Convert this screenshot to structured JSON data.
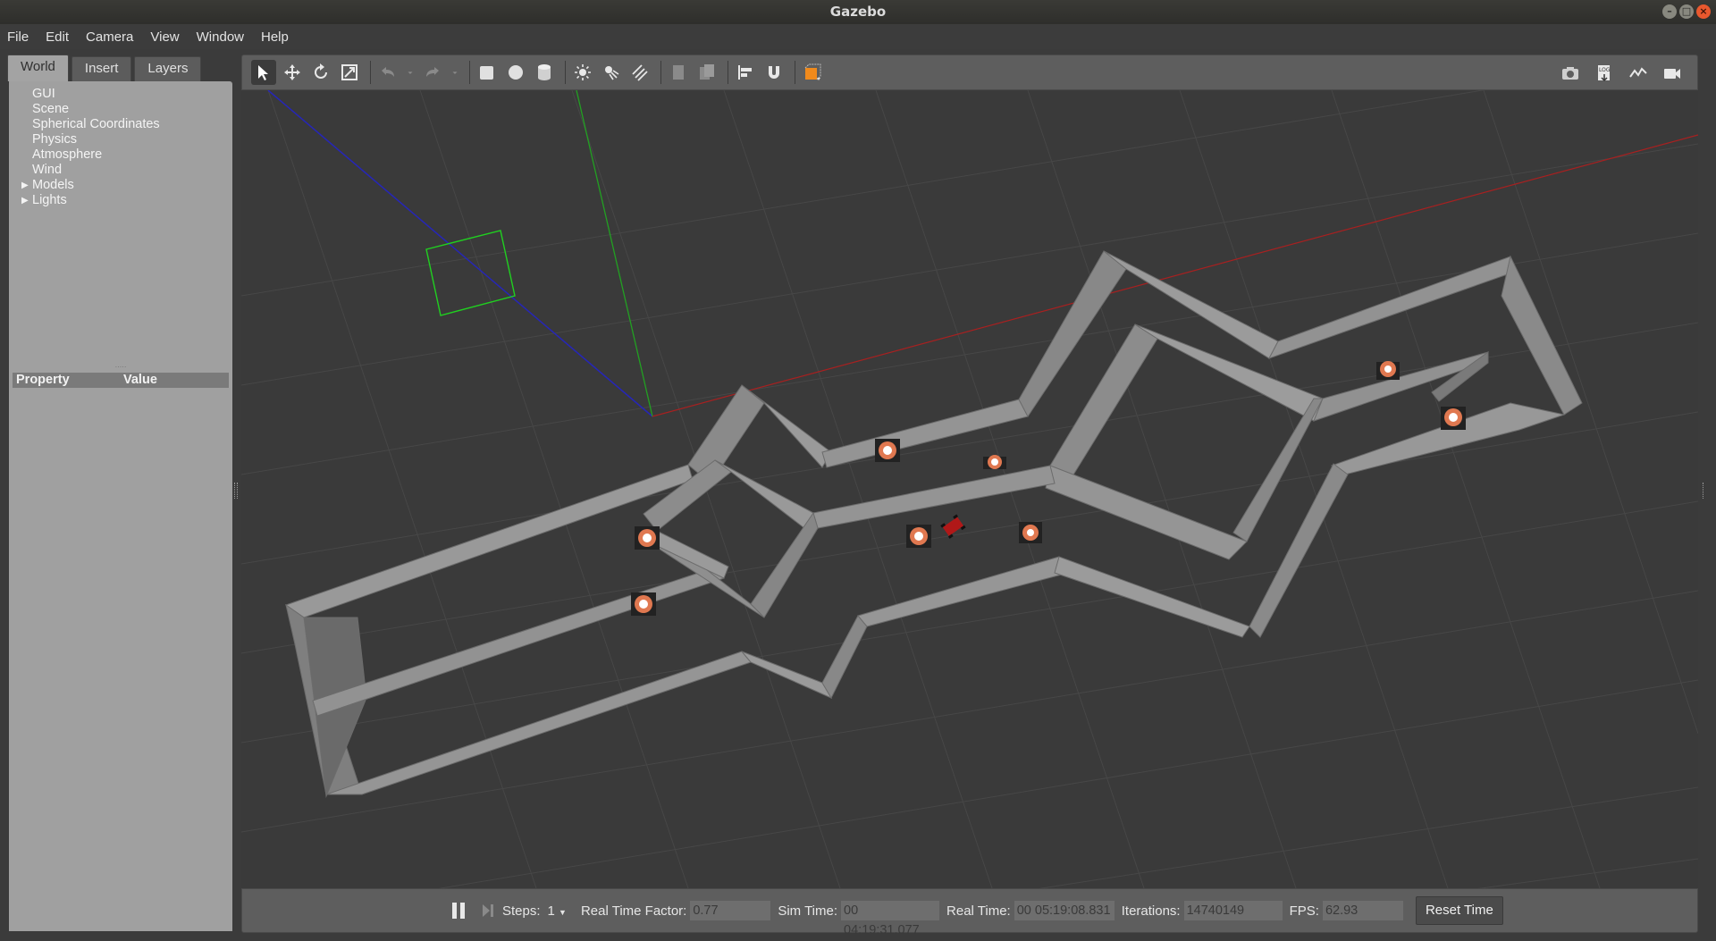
{
  "window": {
    "title": "Gazebo"
  },
  "menu": [
    {
      "label": "File"
    },
    {
      "label": "Edit"
    },
    {
      "label": "Camera"
    },
    {
      "label": "View"
    },
    {
      "label": "Window"
    },
    {
      "label": "Help"
    }
  ],
  "left_panel": {
    "tabs": [
      {
        "label": "World"
      },
      {
        "label": "Insert"
      },
      {
        "label": "Layers"
      }
    ],
    "active_tab": "World",
    "tree": [
      {
        "label": "GUI"
      },
      {
        "label": "Scene"
      },
      {
        "label": "Spherical Coordinates"
      },
      {
        "label": "Physics"
      },
      {
        "label": "Atmosphere"
      },
      {
        "label": "Wind"
      },
      {
        "label": "Models"
      },
      {
        "label": "Lights"
      }
    ],
    "properties": {
      "col_property": "Property",
      "col_value": "Value"
    }
  },
  "toolbar": {
    "left_icons": [
      "select-arrow-icon",
      "translate-icon",
      "rotate-icon",
      "scale-icon",
      "undo-icon",
      "undo-dropdown-icon",
      "redo-icon",
      "redo-dropdown-icon",
      "box-icon",
      "sphere-icon",
      "cylinder-icon",
      "point-light-icon",
      "spot-light-icon",
      "directional-light-icon",
      "copy-icon",
      "paste-icon",
      "align-icon",
      "snap-magnet-icon",
      "view-angle-icon"
    ],
    "right_icons": [
      "screenshot-camera-icon",
      "log-icon",
      "plot-icon",
      "video-record-icon"
    ]
  },
  "bottom_bar": {
    "steps_label": "Steps:",
    "steps_value": "1",
    "rtf_label": "Real Time Factor:",
    "rtf_value": "0.77",
    "sim_time_label": "Sim Time:",
    "sim_time_value": "00 04:19:31.077",
    "real_time_label": "Real Time:",
    "real_time_value": "00 05:19:08.831",
    "iterations_label": "Iterations:",
    "iterations_value": "14740149",
    "fps_label": "FPS:",
    "fps_value": "62.93",
    "reset_label": "Reset Time"
  },
  "colors": {
    "wall": "#8c8c8c",
    "floor": "#3a3a3a",
    "grid": "#4a4a4a",
    "axis_x": "#b02020",
    "axis_y": "#22aa22",
    "axis_z": "#2222bb"
  }
}
